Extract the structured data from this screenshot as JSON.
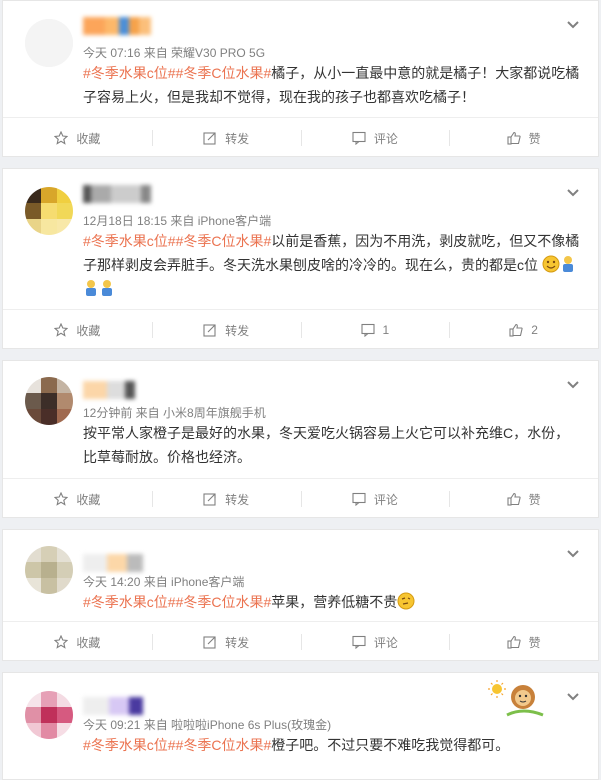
{
  "colors": {
    "hashtag": "#eb7350",
    "meta": "#808080",
    "text": "#333333"
  },
  "posts": [
    {
      "meta": "今天 07:16 来自 荣耀V30 PRO 5G",
      "hashtags": "#冬季水果c位##冬季C位水果#",
      "text_line1": "橘子，从小一直最中意的就是橘子！大家都说吃橘",
      "text_line2": "子容易上火，但是我却不觉得，现在我的孩子也都喜欢吃橘子！",
      "actions": {
        "favorite": "收藏",
        "repost": "转发",
        "comment": "评论",
        "like": "赞"
      }
    },
    {
      "meta": "12月18日 18:15 来自 iPhone客户端",
      "hashtags": "#冬季水果c位##冬季C位水果#",
      "text_line1": "以前是香蕉，因为不用洗，剥皮就吃，但又不像橘",
      "text_line2": "子那样剥皮会弄脏手。冬天洗水果刨皮啥的冷冷的。现在么，贵的都是c位",
      "actions": {
        "favorite": "收藏",
        "repost": "转发",
        "comment": "1",
        "like": "2"
      }
    },
    {
      "meta": "12分钟前 来自 小米8周年旗舰手机",
      "text_line1": "按平常人家橙子是最好的水果，冬天爱吃火锅容易上火它可以补充维C，水份，",
      "text_line2": "比草莓耐放。价格也经济。",
      "actions": {
        "favorite": "收藏",
        "repost": "转发",
        "comment": "评论",
        "like": "赞"
      }
    },
    {
      "meta": "今天 14:20 来自 iPhone客户端",
      "hashtags": "#冬季水果c位##冬季C位水果#",
      "text_line1": "苹果，营养低糖不贵",
      "actions": {
        "favorite": "收藏",
        "repost": "转发",
        "comment": "评论",
        "like": "赞"
      }
    },
    {
      "meta": "今天 09:21 来自 啦啦啦iPhone 6s Plus(玫瑰金)",
      "hashtags": "#冬季水果c位##冬季C位水果#",
      "text_line1": "橙子吧。不过只要不难吃我觉得都可。"
    }
  ]
}
